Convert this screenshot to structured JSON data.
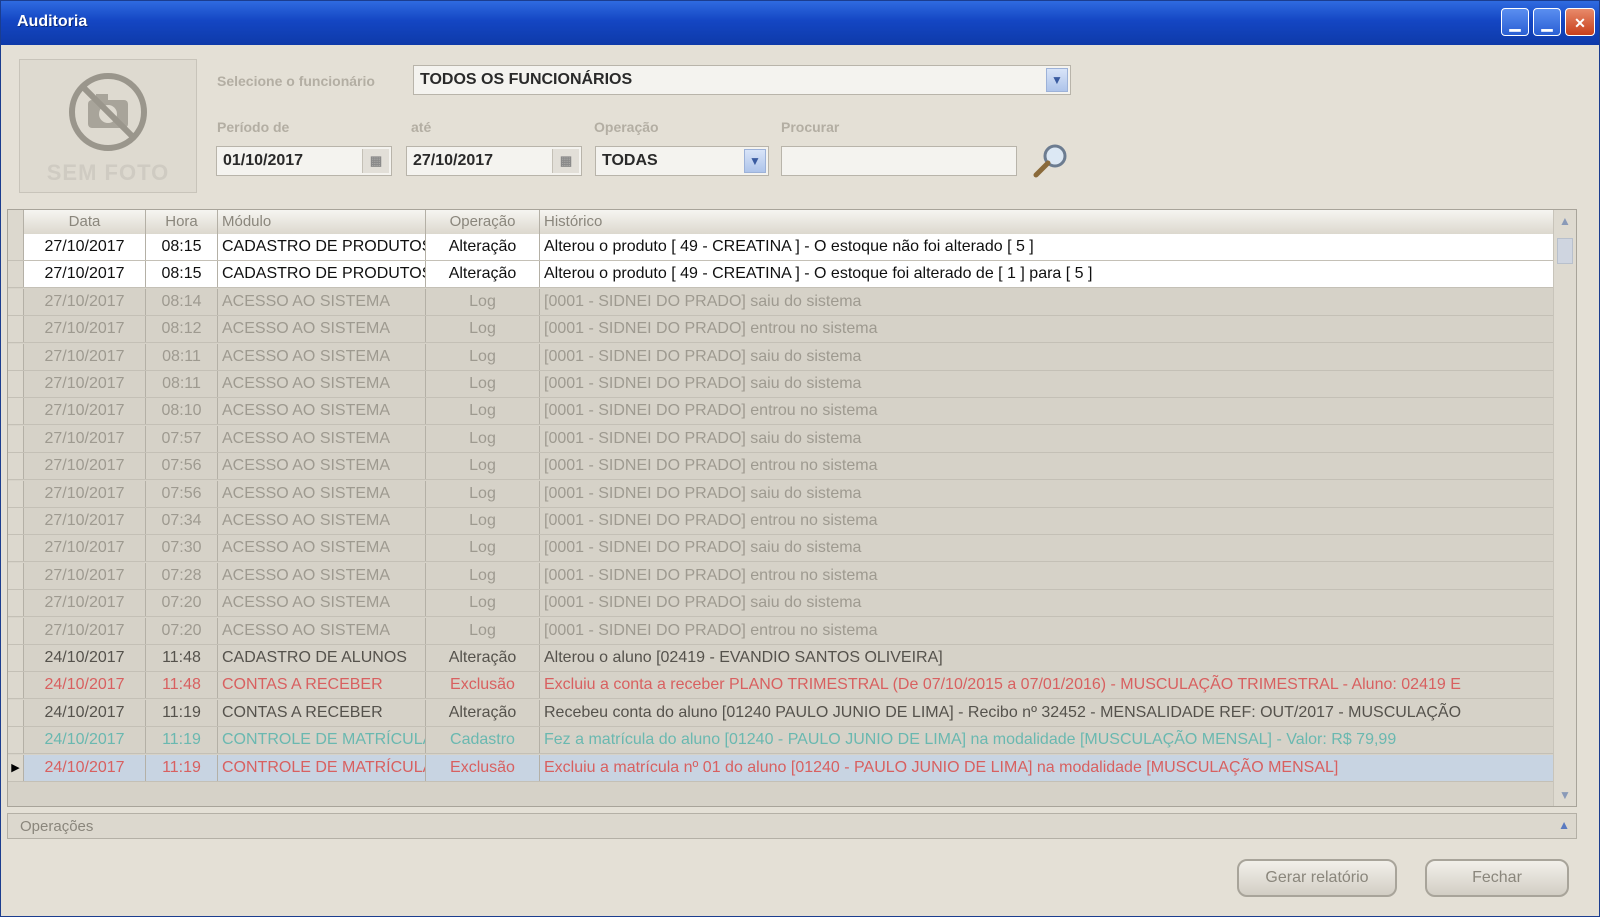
{
  "window": {
    "title": "Auditoria"
  },
  "photo": {
    "placeholder": "SEM FOTO"
  },
  "filters": {
    "employee_label": "Selecione o funcionário",
    "employee_value": "TODOS OS FUNCIONÁRIOS",
    "period_from_label": "Período de",
    "period_from_value": "01/10/2017",
    "period_to_label": "até",
    "period_to_value": "27/10/2017",
    "operation_label": "Operação",
    "operation_value": "TODAS",
    "search_label": "Procurar",
    "search_value": ""
  },
  "grid": {
    "columns": [
      "Data",
      "Hora",
      "Módulo",
      "Operação",
      "Histórico"
    ],
    "rows": [
      {
        "data": "27/10/2017",
        "hora": "08:15",
        "modulo": "CADASTRO DE PRODUTOS",
        "operacao": "Alteração",
        "historico": "Alterou o produto [ 49 - CREATINA ] - O estoque não foi alterado [ 5 ]",
        "style": "white"
      },
      {
        "data": "27/10/2017",
        "hora": "08:15",
        "modulo": "CADASTRO DE PRODUTOS",
        "operacao": "Alteração",
        "historico": "Alterou o produto [ 49 - CREATINA ] - O estoque foi alterado de [ 1 ] para [ 5 ]",
        "style": "white"
      },
      {
        "data": "27/10/2017",
        "hora": "08:14",
        "modulo": "ACESSO AO SISTEMA",
        "operacao": "Log",
        "historico": "[0001 - SIDNEI DO PRADO] saiu do sistema",
        "style": "log"
      },
      {
        "data": "27/10/2017",
        "hora": "08:12",
        "modulo": "ACESSO AO SISTEMA",
        "operacao": "Log",
        "historico": "[0001 - SIDNEI DO PRADO] entrou no sistema",
        "style": "log"
      },
      {
        "data": "27/10/2017",
        "hora": "08:11",
        "modulo": "ACESSO AO SISTEMA",
        "operacao": "Log",
        "historico": "[0001 - SIDNEI DO PRADO] saiu do sistema",
        "style": "log"
      },
      {
        "data": "27/10/2017",
        "hora": "08:11",
        "modulo": "ACESSO AO SISTEMA",
        "operacao": "Log",
        "historico": "[0001 - SIDNEI DO PRADO] saiu do sistema",
        "style": "log"
      },
      {
        "data": "27/10/2017",
        "hora": "08:10",
        "modulo": "ACESSO AO SISTEMA",
        "operacao": "Log",
        "historico": "[0001 - SIDNEI DO PRADO] entrou no sistema",
        "style": "log"
      },
      {
        "data": "27/10/2017",
        "hora": "07:57",
        "modulo": "ACESSO AO SISTEMA",
        "operacao": "Log",
        "historico": "[0001 - SIDNEI DO PRADO] saiu do sistema",
        "style": "log"
      },
      {
        "data": "27/10/2017",
        "hora": "07:56",
        "modulo": "ACESSO AO SISTEMA",
        "operacao": "Log",
        "historico": "[0001 - SIDNEI DO PRADO] entrou no sistema",
        "style": "log"
      },
      {
        "data": "27/10/2017",
        "hora": "07:56",
        "modulo": "ACESSO AO SISTEMA",
        "operacao": "Log",
        "historico": "[0001 - SIDNEI DO PRADO] saiu do sistema",
        "style": "log"
      },
      {
        "data": "27/10/2017",
        "hora": "07:34",
        "modulo": "ACESSO AO SISTEMA",
        "operacao": "Log",
        "historico": "[0001 - SIDNEI DO PRADO] entrou no sistema",
        "style": "log"
      },
      {
        "data": "27/10/2017",
        "hora": "07:30",
        "modulo": "ACESSO AO SISTEMA",
        "operacao": "Log",
        "historico": "[0001 - SIDNEI DO PRADO] saiu do sistema",
        "style": "log"
      },
      {
        "data": "27/10/2017",
        "hora": "07:28",
        "modulo": "ACESSO AO SISTEMA",
        "operacao": "Log",
        "historico": "[0001 - SIDNEI DO PRADO] entrou no sistema",
        "style": "log"
      },
      {
        "data": "27/10/2017",
        "hora": "07:20",
        "modulo": "ACESSO AO SISTEMA",
        "operacao": "Log",
        "historico": "[0001 - SIDNEI DO PRADO] saiu do sistema",
        "style": "log"
      },
      {
        "data": "27/10/2017",
        "hora": "07:20",
        "modulo": "ACESSO AO SISTEMA",
        "operacao": "Log",
        "historico": "[0001 - SIDNEI DO PRADO] entrou no sistema",
        "style": "log"
      },
      {
        "data": "24/10/2017",
        "hora": "11:48",
        "modulo": "CADASTRO DE ALUNOS",
        "operacao": "Alteração",
        "historico": "Alterou o aluno [02419 - EVANDIO SANTOS OLIVEIRA]",
        "style": "dark"
      },
      {
        "data": "24/10/2017",
        "hora": "11:48",
        "modulo": "CONTAS A RECEBER",
        "operacao": "Exclusão",
        "historico": "Excluiu a conta a receber PLANO TRIMESTRAL (De 07/10/2015 a 07/01/2016) - MUSCULAÇÃO TRIMESTRAL - Aluno: 02419 E",
        "style": "red"
      },
      {
        "data": "24/10/2017",
        "hora": "11:19",
        "modulo": "CONTAS A RECEBER",
        "operacao": "Alteração",
        "historico": "Recebeu conta do aluno [01240 PAULO JUNIO DE LIMA] - Recibo nº 32452 - MENSALIDADE REF: OUT/2017 - MUSCULAÇÃO",
        "style": "dark"
      },
      {
        "data": "24/10/2017",
        "hora": "11:19",
        "modulo": "CONTROLE DE MATRÍCULA",
        "operacao": "Cadastro",
        "historico": "Fez a matrícula do aluno [01240 - PAULO JUNIO DE LIMA] na modalidade [MUSCULAÇÃO MENSAL] - Valor: R$ 79,99",
        "style": "green"
      },
      {
        "data": "24/10/2017",
        "hora": "11:19",
        "modulo": "CONTROLE DE MATRÍCULA",
        "operacao": "Exclusão",
        "historico": "Excluiu a matrícula nº 01 do aluno [01240 - PAULO JUNIO DE LIMA] na modalidade [MUSCULAÇÃO MENSAL]",
        "style": "selected",
        "current": true
      }
    ]
  },
  "operations_bar": {
    "label": "Operações"
  },
  "buttons": {
    "report": "Gerar relatório",
    "close": "Fechar"
  },
  "colors": {
    "titlebar": "#1446c3",
    "window_bg": "#e4e0d6",
    "red_text": "#d86060",
    "green_text": "#6ab8b0"
  }
}
